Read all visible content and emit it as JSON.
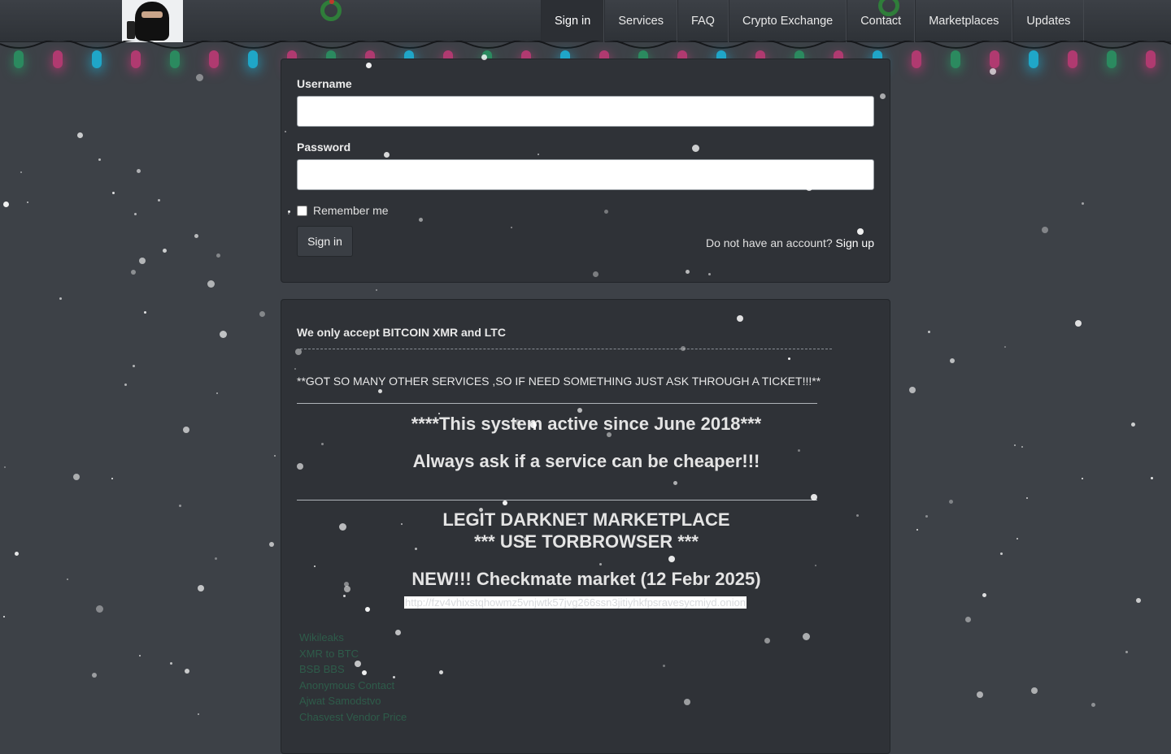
{
  "nav": {
    "items": [
      "Sign in",
      "Services",
      "FAQ",
      "Crypto Exchange",
      "Contact",
      "Marketplaces",
      "Updates"
    ],
    "active": "Sign in"
  },
  "login": {
    "username_label": "Username",
    "password_label": "Password",
    "remember_label": "Remember me",
    "signin_button": "Sign in",
    "no_account_text": "Do not have an account?",
    "signup_link": "Sign up"
  },
  "info": {
    "accept": "We only accept BITCOIN XMR and LTC",
    "other_services": "**GOT SO MANY OTHER SERVICES ,SO IF NEED SOMETHING JUST ASK THROUGH A TICKET!!!**",
    "active_since": "****This system active since June 2018***",
    "cheaper": "Always ask if a service can be cheaper!!!",
    "legit": "LEGIT DARKNET MARKETPLACE",
    "torbrowser": "*** USE TORBROWSER ***",
    "new_market": "NEW!!! Checkmate market (12 Febr 2025)",
    "onion_url": "http://fzv4vhixstqhowmz5vnjwtk57jvg266ssn3jitiyhkfpsravesycmiyd.onion",
    "links": [
      "Wikileaks",
      "XMR to BTC",
      "BSB BBS",
      "Anonymous Contact",
      "Ajwat Samodstvo",
      "Chasvest Vendor Price"
    ]
  },
  "colors": {
    "page_bg": "#3d4147",
    "panel_bg": "#2f3237",
    "bulb_green": "#2b8a5f",
    "bulb_pink": "#b03a70",
    "bulb_cyan": "#1fa6c8"
  }
}
